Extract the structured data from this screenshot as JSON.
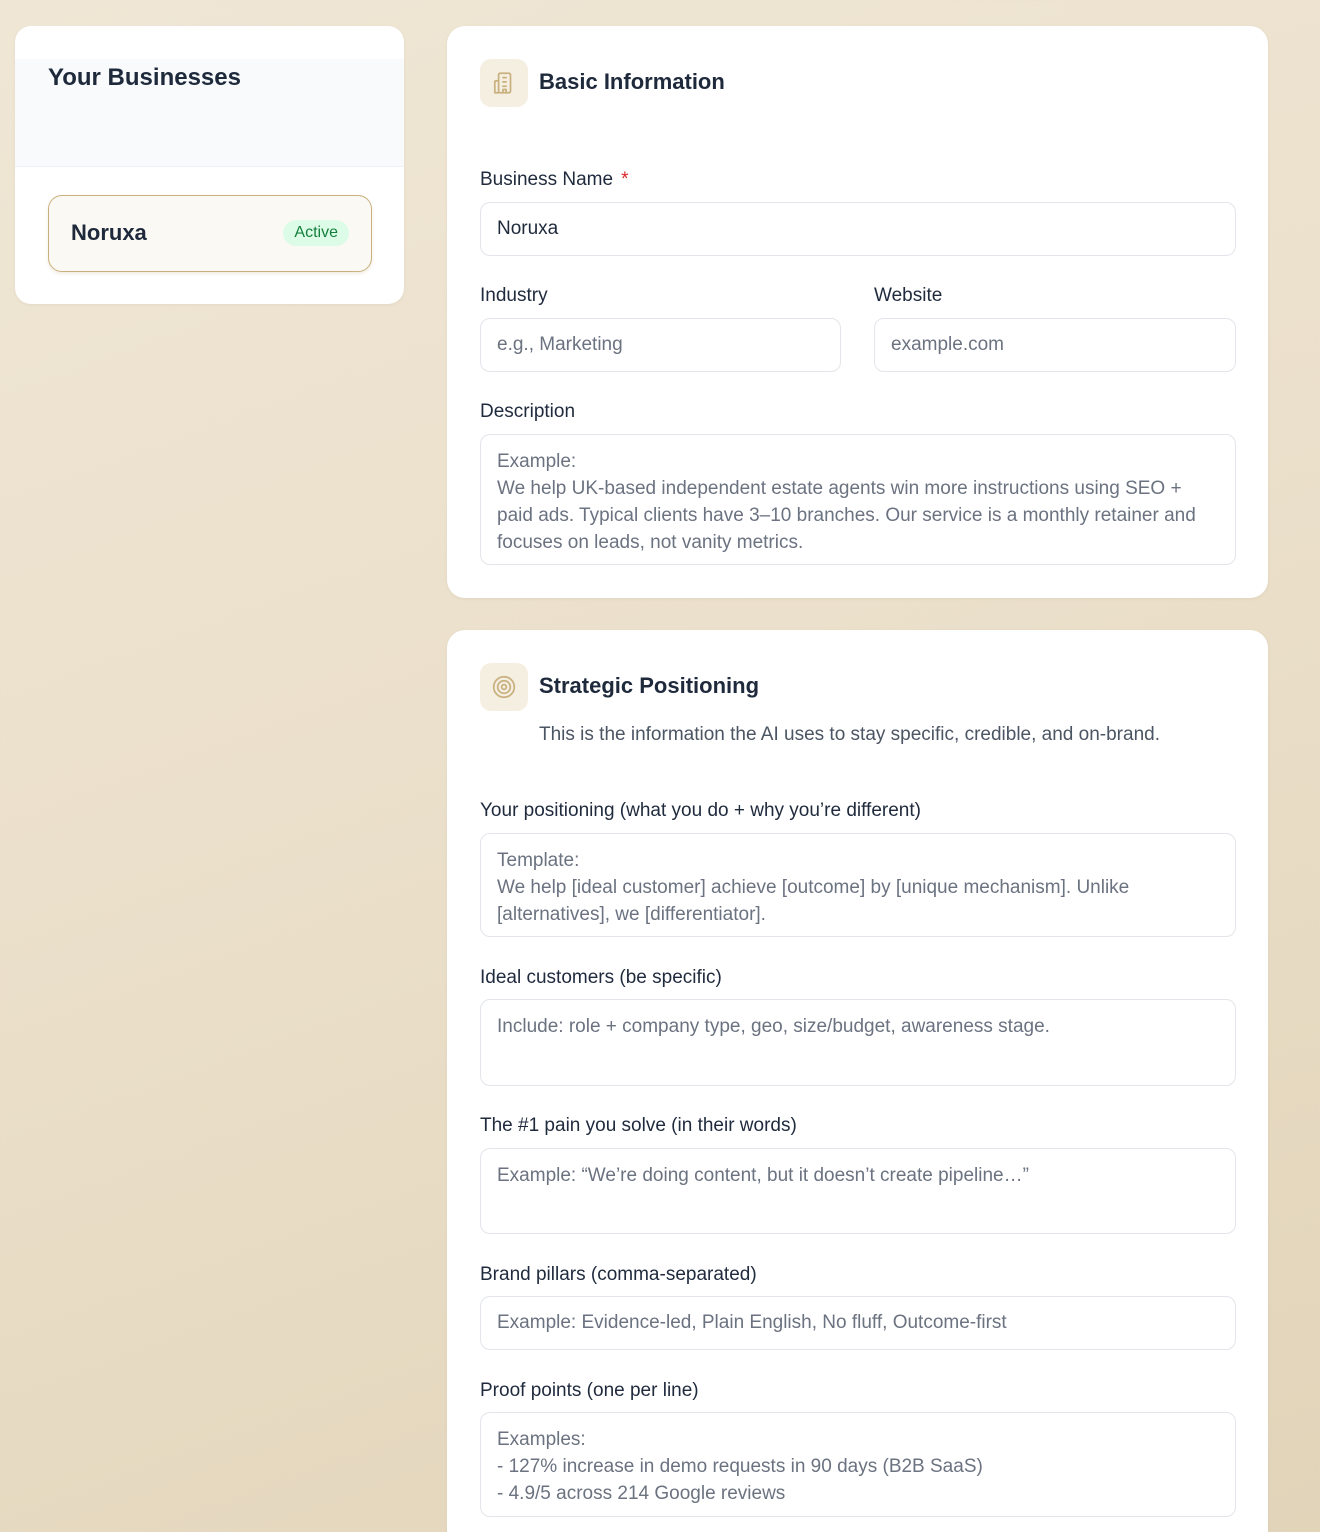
{
  "sidebar": {
    "title": "Your Businesses",
    "businesses": [
      {
        "name": "Noruxa",
        "status": "Active"
      }
    ]
  },
  "basic_info": {
    "title": "Basic Information",
    "icon": "building-icon",
    "business_name": {
      "label": "Business Name",
      "required_mark": "*",
      "value": "Noruxa"
    },
    "industry": {
      "label": "Industry",
      "placeholder": "e.g., Marketing"
    },
    "website": {
      "label": "Website",
      "placeholder": "example.com"
    },
    "description": {
      "label": "Description",
      "placeholder": "Example:\nWe help UK-based independent estate agents win more instructions using SEO + paid ads. Typical clients have 3–10 branches. Our service is a monthly retainer and focuses on leads, not vanity metrics."
    }
  },
  "strategic": {
    "title": "Strategic Positioning",
    "icon": "target-icon",
    "subtitle": "This is the information the AI uses to stay specific, credible, and on-brand.",
    "positioning": {
      "label": "Your positioning (what you do + why you’re different)",
      "placeholder": "Template:\nWe help [ideal customer] achieve [outcome] by [unique mechanism]. Unlike [alternatives], we [differentiator]."
    },
    "ideal_customers": {
      "label": "Ideal customers (be specific)",
      "placeholder": "Include: role + company type, geo, size/budget, awareness stage."
    },
    "pain": {
      "label": "The #1 pain you solve (in their words)",
      "placeholder": "Example: “We’re doing content, but it doesn’t create pipeline…”"
    },
    "brand_pillars": {
      "label": "Brand pillars (comma-separated)",
      "placeholder": "Example: Evidence-led, Plain English, No fluff, Outcome-first"
    },
    "proof_points": {
      "label": "Proof points (one per line)",
      "placeholder": "Examples:\n- 127% increase in demo requests in 90 days (B2B SaaS)\n- 4.9/5 across 214 Google reviews"
    }
  },
  "colors": {
    "accent": "#c9b07e",
    "active_badge_bg": "#dcfce7",
    "active_badge_text": "#15803d",
    "required": "#dc2626"
  }
}
